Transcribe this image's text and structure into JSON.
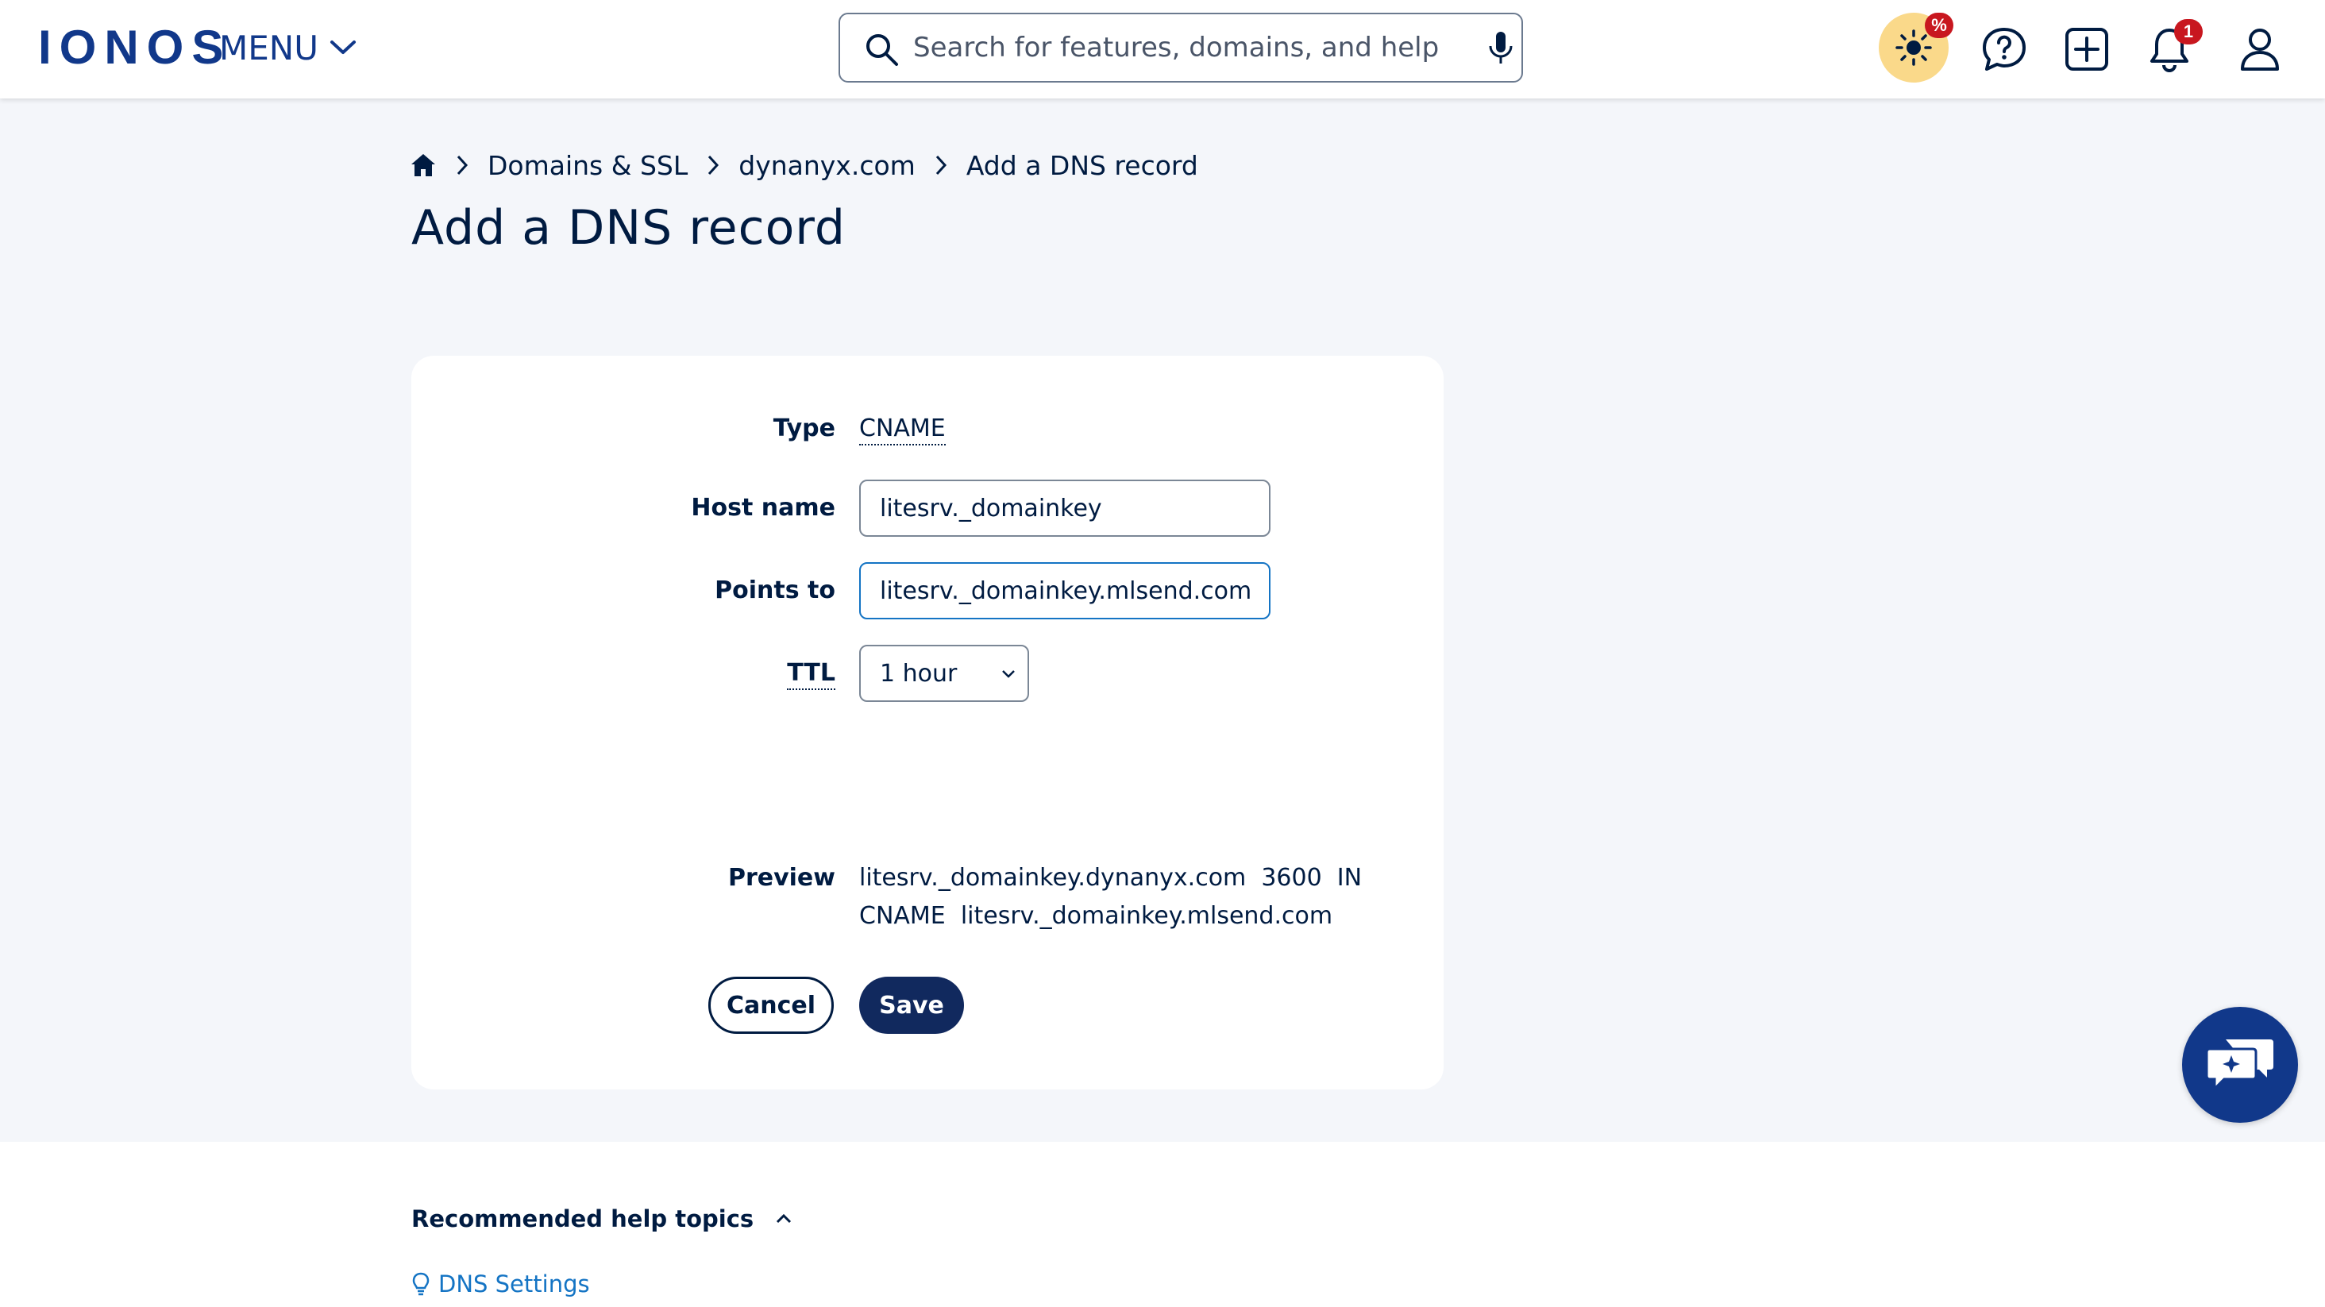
{
  "header": {
    "logo": "IONOS",
    "menu_label": "MENU",
    "search_placeholder": "Search for features, domains, and help",
    "promo_badge": "%",
    "notifications_count": "1"
  },
  "breadcrumb": {
    "items": [
      "Domains & SSL",
      "dynanyx.com",
      "Add a DNS record"
    ]
  },
  "page": {
    "title": "Add a DNS record"
  },
  "form": {
    "type_label": "Type",
    "type_value": "CNAME",
    "host_label": "Host name",
    "host_value": "litesrv._domainkey",
    "points_label": "Points to",
    "points_value": "litesrv._domainkey.mlsend.com",
    "ttl_label": "TTL",
    "ttl_value": "1 hour",
    "preview_label": "Preview",
    "preview_line1": "litesrv._domainkey.dynanyx.com  3600  IN",
    "preview_line2": "CNAME  litesrv._domainkey.mlsend.com",
    "cancel_label": "Cancel",
    "save_label": "Save"
  },
  "help": {
    "title": "Recommended help topics",
    "links": [
      "DNS Settings"
    ]
  },
  "colors": {
    "brand": "#11388a",
    "text": "#001b41",
    "save_button": "#11295e",
    "link": "#1474c4",
    "page_bg": "#f4f6fa",
    "promo_bg": "#fad98a",
    "badge": "#c8171f"
  }
}
